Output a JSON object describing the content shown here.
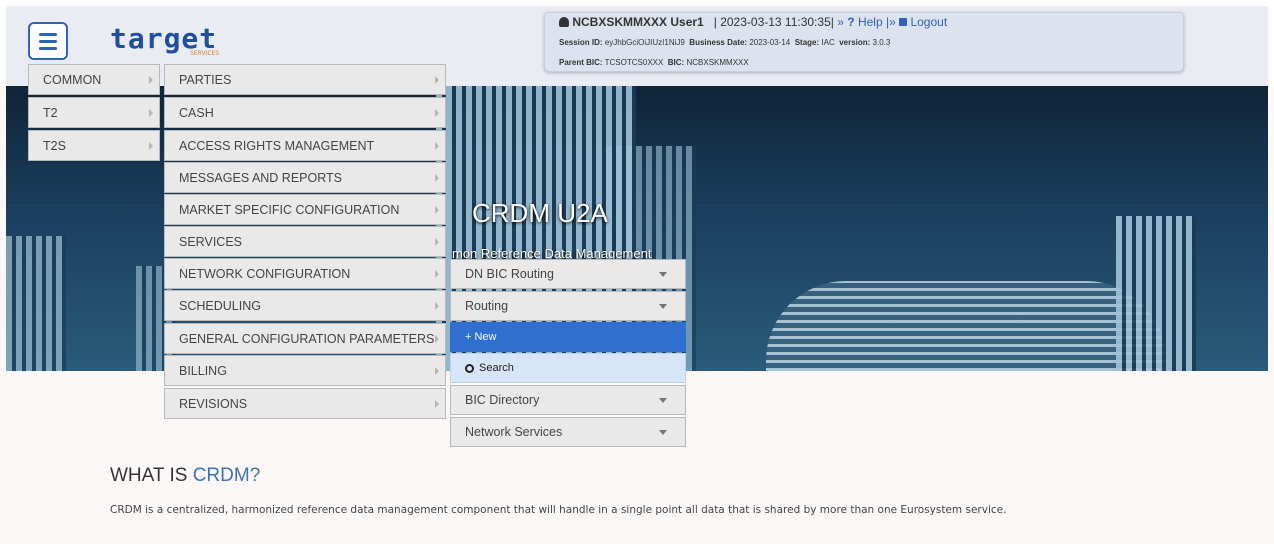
{
  "header": {
    "logo": "target",
    "logo_sub": "SERVICES",
    "session": {
      "user": "NCBXSKMMXXX User1",
      "datetime": "2023-03-13 11:30:35",
      "sep1": "|",
      "help_prefix": "»",
      "help": "Help",
      "sep2": "|»",
      "logout": "Logout",
      "session_id_label": "Session ID:",
      "session_id": "eyJhbGciOiJIUzI1NiJ9",
      "business_date_label": "Business Date:",
      "business_date": "2023-03-14",
      "stage_label": "Stage:",
      "stage": "IAC",
      "version_label": "version:",
      "version": "3.0.3",
      "parent_bic_label": "Parent BIC:",
      "parent_bic": "TCSOTCS0XXX",
      "bic_label": "BIC:",
      "bic": "NCBXSKMMXXX"
    }
  },
  "hero": {
    "title": "CRDM U2A",
    "subtitle": "mon Reference Data Management"
  },
  "menu": {
    "level1": [
      "COMMON",
      "T2",
      "T2S"
    ],
    "level2": [
      "PARTIES",
      "CASH",
      "ACCESS RIGHTS MANAGEMENT",
      "MESSAGES AND REPORTS",
      "MARKET SPECIFIC CONFIGURATION",
      "SERVICES",
      "NETWORK CONFIGURATION",
      "SCHEDULING",
      "GENERAL CONFIGURATION PARAMETERS",
      "BILLING",
      "REVISIONS"
    ],
    "level3": {
      "dn_bic_routing": "DN BIC Routing",
      "routing": "Routing",
      "new": "+ New",
      "search": "Search",
      "bic_directory": "BIC Directory",
      "network_services": "Network Services"
    }
  },
  "content": {
    "heading_plain": "WHAT IS",
    "heading_highlight": "CRDM?",
    "paragraph": "CRDM is a centralized, harmonized reference data management component that will handle in a single point all data that is shared by more than one Eurosystem service."
  },
  "colors": {
    "accent": "#2f6fcf",
    "logo": "#1f4fa0"
  }
}
